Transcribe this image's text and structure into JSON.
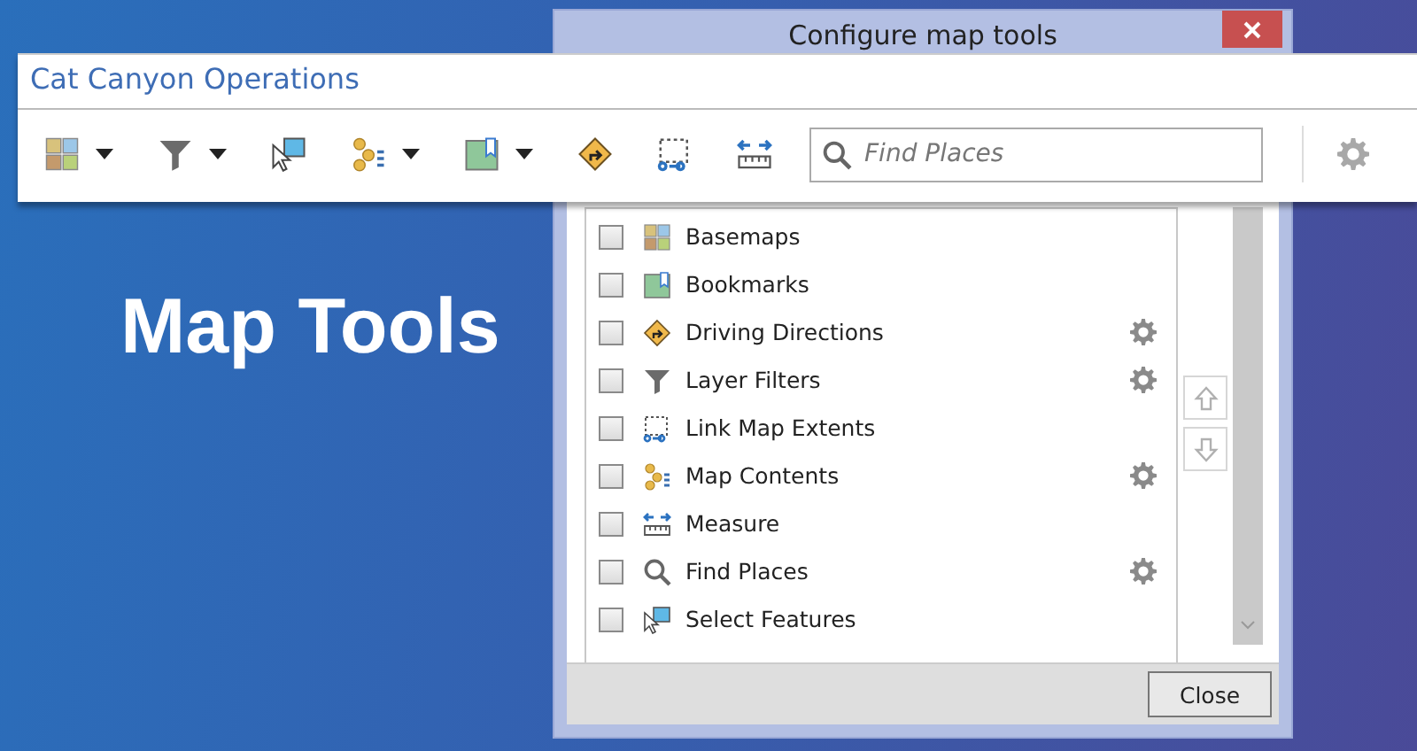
{
  "slide": {
    "heading": "Map Tools"
  },
  "dialog": {
    "title": "Configure map tools",
    "tools": [
      {
        "label": "Basemaps",
        "kind": "basemaps",
        "checked": false,
        "configurable": false
      },
      {
        "label": "Bookmarks",
        "kind": "bookmarks",
        "checked": false,
        "configurable": false
      },
      {
        "label": "Driving Directions",
        "kind": "directions",
        "checked": false,
        "configurable": true
      },
      {
        "label": "Layer Filters",
        "kind": "filter",
        "checked": false,
        "configurable": true
      },
      {
        "label": "Link Map Extents",
        "kind": "link",
        "checked": false,
        "configurable": false
      },
      {
        "label": "Map Contents",
        "kind": "contents",
        "checked": false,
        "configurable": true
      },
      {
        "label": "Measure",
        "kind": "measure",
        "checked": false,
        "configurable": false
      },
      {
        "label": "Find Places",
        "kind": "find",
        "checked": false,
        "configurable": true
      },
      {
        "label": "Select Features",
        "kind": "select",
        "checked": false,
        "configurable": false
      }
    ],
    "close_button": "Close"
  },
  "app_window": {
    "title": "Cat Canyon Operations",
    "toolbar": [
      {
        "kind": "basemaps",
        "dropdown": true
      },
      {
        "kind": "filter",
        "dropdown": true
      },
      {
        "kind": "select",
        "dropdown": false
      },
      {
        "kind": "contents",
        "dropdown": true
      },
      {
        "kind": "bookmarks",
        "dropdown": true
      },
      {
        "kind": "directions",
        "dropdown": false
      },
      {
        "kind": "link",
        "dropdown": false
      },
      {
        "kind": "measure",
        "dropdown": false
      }
    ],
    "search": {
      "placeholder": "Find Places"
    }
  }
}
